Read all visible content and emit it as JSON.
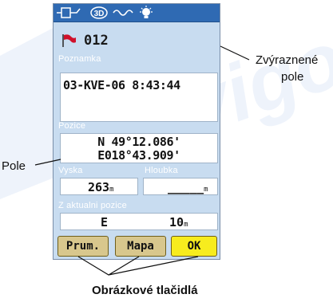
{
  "status_bar": {
    "icons": [
      "backlight-icon",
      "3d-fix-icon",
      "signal-wave-icon",
      "sun-icon"
    ],
    "fix_label": "3D"
  },
  "waypoint": {
    "flag_color": "#d0102a",
    "name": "012"
  },
  "note": {
    "label": "Poznamka",
    "text": "03-KVE-06 8:43:44"
  },
  "position": {
    "label": "Pozice",
    "lat": "N 49°12.086'",
    "lon": "E018°43.909'"
  },
  "altitude": {
    "label": "Vyska",
    "value": "263",
    "unit": "m"
  },
  "depth": {
    "label": "Hloubka",
    "value": "_____",
    "unit": "m"
  },
  "from_current": {
    "label": "Z aktualni pozice",
    "bearing": "E",
    "distance": "10",
    "unit": "m"
  },
  "buttons": {
    "average": "Prum.",
    "map": "Mapa",
    "ok": "OK"
  },
  "callouts": {
    "highlighted_field_line1": "Zvýraznené",
    "highlighted_field_line2": "pole",
    "field": "Pole",
    "image_buttons": "Obrázkové tlačidlá"
  },
  "colors": {
    "screen_bg": "#c8dcf0",
    "status_bar": "#2f6ab3",
    "ok_button": "#f7ec1e",
    "button": "#d8c78d"
  }
}
